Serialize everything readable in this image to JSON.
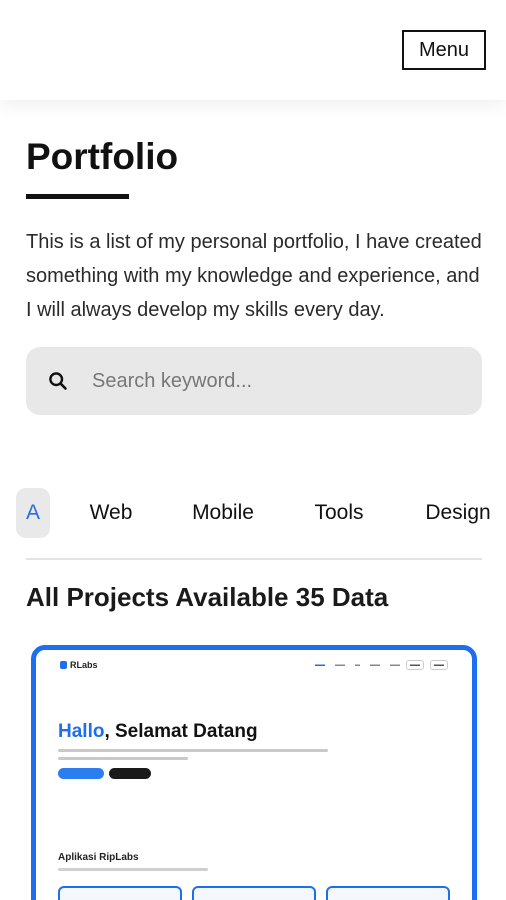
{
  "header": {
    "menu_label": "Menu"
  },
  "portfolio": {
    "title": "Portfolio",
    "description": "This is a list of my personal portfolio, I have created something with my knowledge and experience, and I will always develop my skills every day."
  },
  "search": {
    "placeholder": "Search keyword...",
    "value": "",
    "icon": "search-icon"
  },
  "tabs": [
    {
      "label": "A",
      "active": true
    },
    {
      "label": "Web",
      "active": false
    },
    {
      "label": "Mobile",
      "active": false
    },
    {
      "label": "Tools",
      "active": false
    },
    {
      "label": "Design",
      "active": false
    }
  ],
  "projects": {
    "heading": "All Projects Available 35 Data",
    "accent_color": "#1e6ef0",
    "items": [
      {
        "preview": {
          "logo": "RLabs",
          "hero_title_highlight": "Hallo",
          "hero_title_rest": ", Selamat Datang",
          "section_title": "Aplikasi RipLabs"
        }
      }
    ]
  },
  "colors": {
    "active_tab_text": "#2b6de0",
    "active_tab_bg": "#e9e9e9",
    "search_bg": "#e8e8e8",
    "card_border": "#1e6ef0"
  }
}
